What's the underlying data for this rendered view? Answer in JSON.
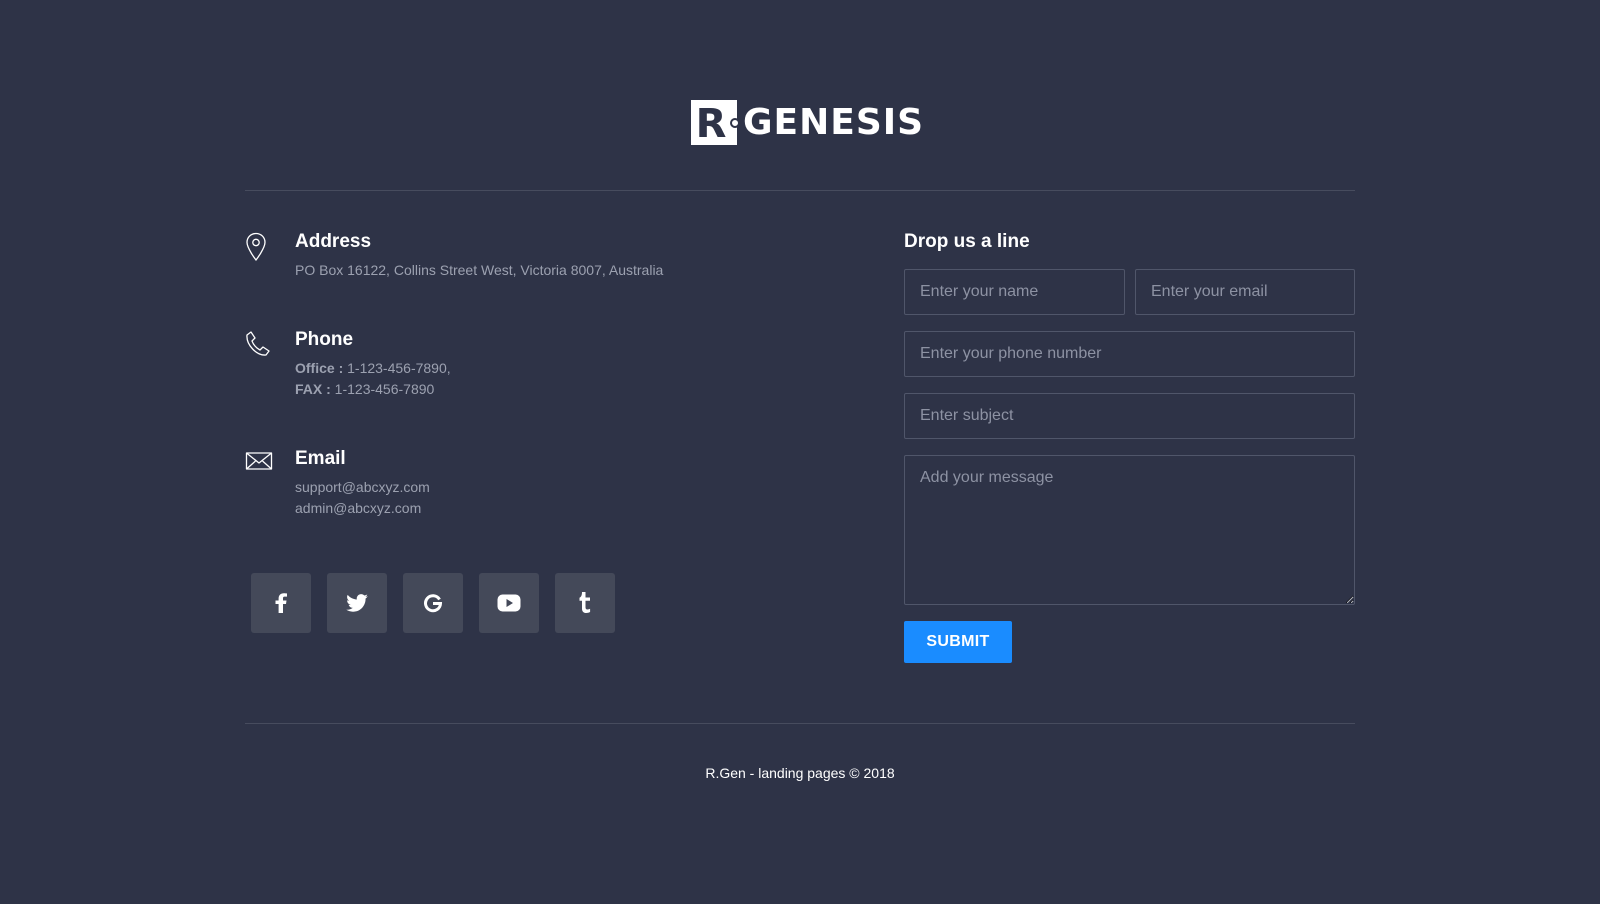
{
  "brand": {
    "logo_mark": "R",
    "logo_text": "GENESIS"
  },
  "contact": {
    "address": {
      "icon": "map-pin-icon",
      "title": "Address",
      "line": "PO Box 16122, Collins Street West, Victoria 8007, Australia"
    },
    "phone": {
      "icon": "phone-icon",
      "title": "Phone",
      "office_label": "Office :",
      "office_value": "1-123-456-7890,",
      "fax_label": "FAX :",
      "fax_value": "1-123-456-7890"
    },
    "email": {
      "icon": "envelope-icon",
      "title": "Email",
      "lines": [
        "support@abcxyz.com",
        "admin@abcxyz.com"
      ]
    }
  },
  "socials": [
    {
      "name": "facebook",
      "icon": "facebook-icon"
    },
    {
      "name": "twitter",
      "icon": "twitter-icon"
    },
    {
      "name": "google",
      "icon": "google-icon"
    },
    {
      "name": "youtube",
      "icon": "youtube-icon"
    },
    {
      "name": "tumblr",
      "icon": "tumblr-icon"
    }
  ],
  "form": {
    "title": "Drop us a line",
    "name_placeholder": "Enter your name",
    "email_placeholder": "Enter your email",
    "phone_placeholder": "Enter your phone number",
    "subject_placeholder": "Enter subject",
    "message_placeholder": "Add your message",
    "submit_label": "SUBMIT"
  },
  "footer": {
    "copyright": "R.Gen - landing pages © 2018"
  },
  "colors": {
    "background": "#2e3347",
    "accent": "#1a8cff",
    "social_bg": "#444959",
    "muted_text": "#9ca1b0"
  }
}
